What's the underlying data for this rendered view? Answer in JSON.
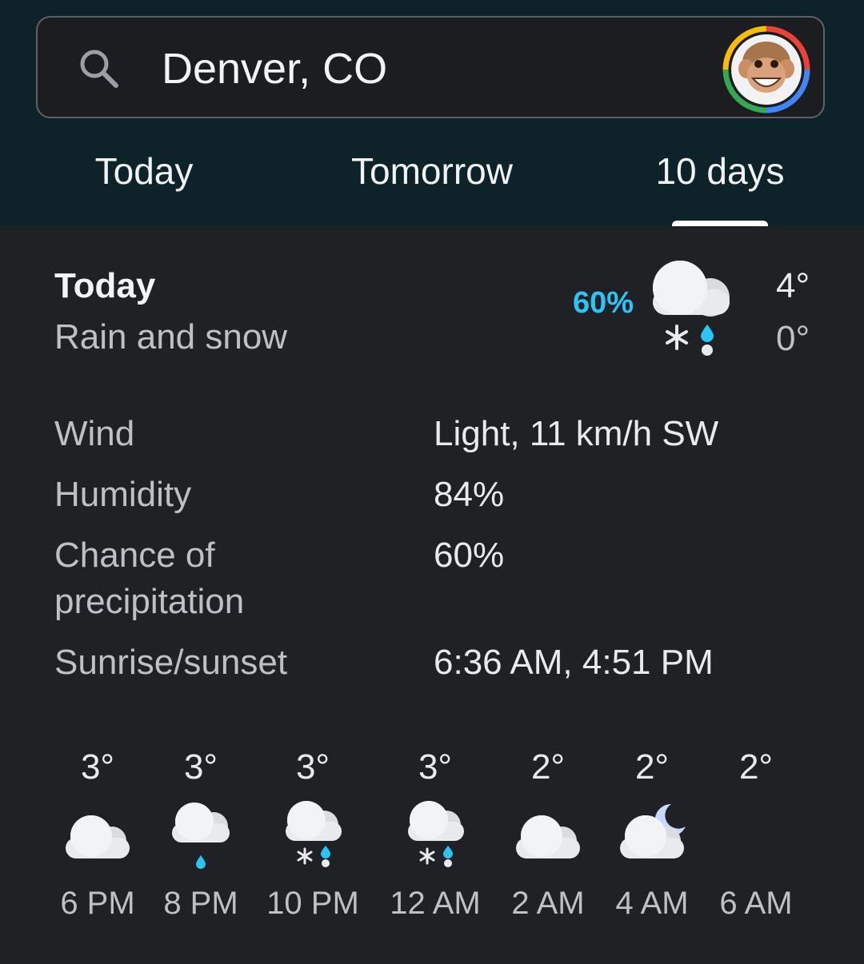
{
  "search": {
    "location": "Denver, CO"
  },
  "tabs": [
    {
      "label": "Today"
    },
    {
      "label": "Tomorrow"
    },
    {
      "label": "10 days",
      "selected": true
    }
  ],
  "summary": {
    "day": "Today",
    "condition": "Rain and snow",
    "precip_chance": "60%",
    "icon": "cloud-rain-snow-icon",
    "high": "4°",
    "low": "0°"
  },
  "details": [
    {
      "label": "Wind",
      "value": "Light, 11 km/h SW"
    },
    {
      "label": "Humidity",
      "value": "84%"
    },
    {
      "label": "Chance of\nprecipitation",
      "value": "60%"
    },
    {
      "label": "Sunrise/sunset",
      "value": "6:36 AM, 4:51 PM"
    }
  ],
  "hourly": [
    {
      "temp": "3°",
      "time": "6 PM",
      "icon": "cloudy-icon"
    },
    {
      "temp": "3°",
      "time": "8 PM",
      "icon": "cloud-rain-icon"
    },
    {
      "temp": "3°",
      "time": "10 PM",
      "icon": "cloud-rain-snow-icon"
    },
    {
      "temp": "3°",
      "time": "12 AM",
      "icon": "cloud-rain-snow-icon"
    },
    {
      "temp": "2°",
      "time": "2 AM",
      "icon": "cloudy-icon"
    },
    {
      "temp": "2°",
      "time": "4 AM",
      "icon": "cloudy-night-icon"
    },
    {
      "temp": "2°",
      "time": "6 AM",
      "icon": "moon-icon"
    }
  ],
  "colors": {
    "header_bg": "#0e2329",
    "body_bg": "#202124",
    "precip_accent": "#29c5f6",
    "moon": "#c8d7ff"
  }
}
